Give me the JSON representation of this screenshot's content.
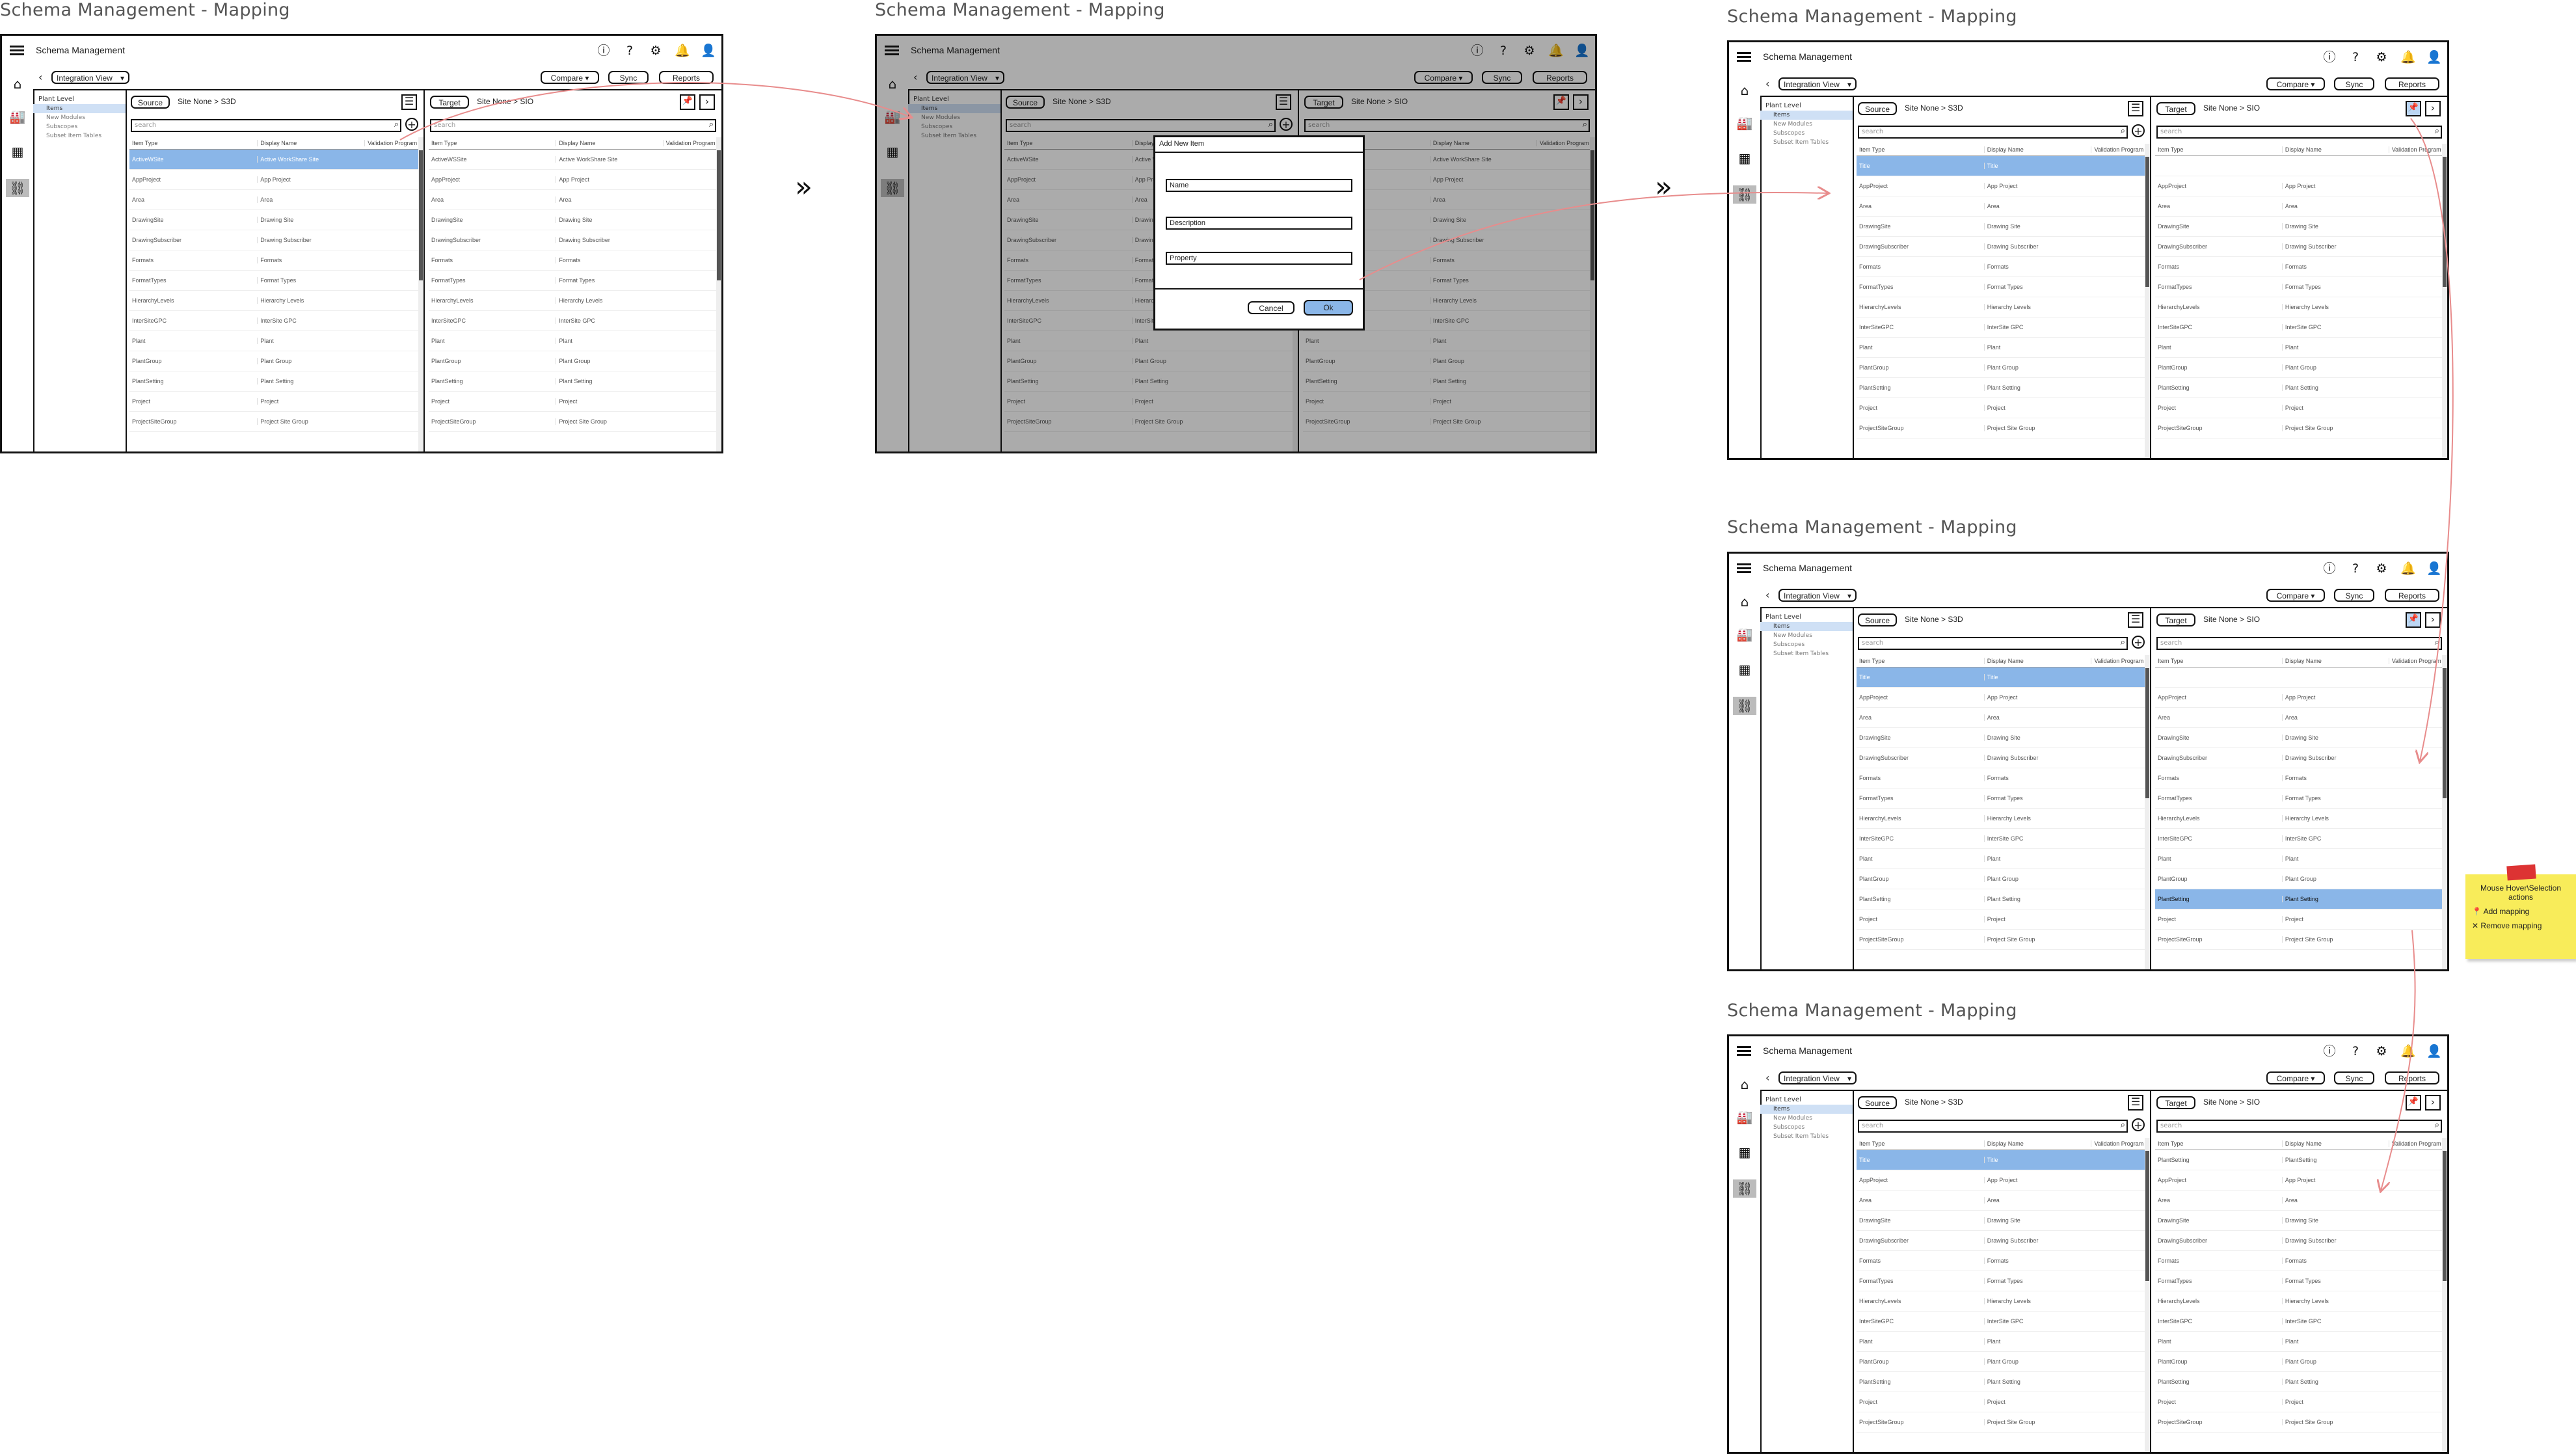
{
  "frame_title": "Schema Management - Mapping",
  "app_title": "Schema Management",
  "view_select": "Integration View",
  "compare": "Compare",
  "sync": "Sync",
  "reports": "Reports",
  "source_label": "Source",
  "source_path": "Site None > S3D",
  "target_label": "Target",
  "target_path": "Site None > SIO",
  "search_placeholder": "search",
  "col_item_type": "Item Type",
  "col_display_name": "Display Name",
  "col_validation": "Validation Program",
  "tree": {
    "root": "Plant Level",
    "items": [
      "Items",
      "New Modules",
      "Subscopes",
      "Subset Item Tables"
    ]
  },
  "source_rows_a": [
    [
      "ActiveWSite",
      "Active WorkShare Site"
    ],
    [
      "AppProject",
      "App Project"
    ],
    [
      "Area",
      "Area"
    ],
    [
      "DrawingSite",
      "Drawing Site"
    ],
    [
      "DrawingSubscriber",
      "Drawing Subscriber"
    ],
    [
      "Formats",
      "Formats"
    ],
    [
      "FormatTypes",
      "Format Types"
    ],
    [
      "HierarchyLevels",
      "Hierarchy Levels"
    ],
    [
      "InterSiteGPC",
      "InterSite GPC"
    ],
    [
      "Plant",
      "Plant"
    ],
    [
      "PlantGroup",
      "Plant Group"
    ],
    [
      "PlantSetting",
      "Plant Setting"
    ],
    [
      "Project",
      "Project"
    ],
    [
      "ProjectSiteGroup",
      "Project Site Group"
    ]
  ],
  "source_rows_b": [
    [
      "Title",
      "Title"
    ],
    [
      "AppProject",
      "App Project"
    ],
    [
      "Area",
      "Area"
    ],
    [
      "DrawingSite",
      "Drawing Site"
    ],
    [
      "DrawingSubscriber",
      "Drawing Subscriber"
    ],
    [
      "Formats",
      "Formats"
    ],
    [
      "FormatTypes",
      "Format Types"
    ],
    [
      "HierarchyLevels",
      "Hierarchy Levels"
    ],
    [
      "InterSiteGPC",
      "InterSite GPC"
    ],
    [
      "Plant",
      "Plant"
    ],
    [
      "PlantGroup",
      "Plant Group"
    ],
    [
      "PlantSetting",
      "Plant Setting"
    ],
    [
      "Project",
      "Project"
    ],
    [
      "ProjectSiteGroup",
      "Project Site Group"
    ]
  ],
  "target_rows_a": [
    [
      "ActiveWSSite",
      "Active WorkShare Site"
    ],
    [
      "AppProject",
      "App Project"
    ],
    [
      "Area",
      "Area"
    ],
    [
      "DrawingSite",
      "Drawing Site"
    ],
    [
      "DrawingSubscriber",
      "Drawing Subscriber"
    ],
    [
      "Formats",
      "Formats"
    ],
    [
      "FormatTypes",
      "Format Types"
    ],
    [
      "HierarchyLevels",
      "Hierarchy Levels"
    ],
    [
      "InterSiteGPC",
      "InterSite GPC"
    ],
    [
      "Plant",
      "Plant"
    ],
    [
      "PlantGroup",
      "Plant Group"
    ],
    [
      "PlantSetting",
      "Plant Setting"
    ],
    [
      "Project",
      "Project"
    ],
    [
      "ProjectSiteGroup",
      "Project Site Group"
    ]
  ],
  "target_rows_b": [
    [
      "",
      ""
    ],
    [
      "AppProject",
      "App Project"
    ],
    [
      "Area",
      "Area"
    ],
    [
      "DrawingSite",
      "Drawing Site"
    ],
    [
      "DrawingSubscriber",
      "Drawing Subscriber"
    ],
    [
      "Formats",
      "Formats"
    ],
    [
      "FormatTypes",
      "Format Types"
    ],
    [
      "HierarchyLevels",
      "Hierarchy Levels"
    ],
    [
      "InterSiteGPC",
      "InterSite GPC"
    ],
    [
      "Plant",
      "Plant"
    ],
    [
      "PlantGroup",
      "Plant Group"
    ],
    [
      "PlantSetting",
      "Plant Setting"
    ],
    [
      "Project",
      "Project"
    ],
    [
      "ProjectSiteGroup",
      "Project Site Group"
    ]
  ],
  "target_rows_c": [
    [
      "PlantSetting",
      "PlantSetting"
    ],
    [
      "AppProject",
      "App Project"
    ],
    [
      "Area",
      "Area"
    ],
    [
      "DrawingSite",
      "Drawing Site"
    ],
    [
      "DrawingSubscriber",
      "Drawing Subscriber"
    ],
    [
      "Formats",
      "Formats"
    ],
    [
      "FormatTypes",
      "Format Types"
    ],
    [
      "HierarchyLevels",
      "Hierarchy Levels"
    ],
    [
      "InterSiteGPC",
      "InterSite GPC"
    ],
    [
      "Plant",
      "Plant"
    ],
    [
      "PlantGroup",
      "Plant Group"
    ],
    [
      "PlantSetting",
      "Plant Setting"
    ],
    [
      "Project",
      "Project"
    ],
    [
      "ProjectSiteGroup",
      "Project Site Group"
    ]
  ],
  "dialog": {
    "title": "Add New Item",
    "name": "Name",
    "description": "Description",
    "property": "Property",
    "cancel": "Cancel",
    "ok": "Ok"
  },
  "sticky": {
    "title": "Mouse Hover\\Selection actions",
    "add": "Add mapping",
    "remove": "Remove mapping"
  },
  "colors": {
    "selection": "#8ab6e8",
    "arrow": "#e88c8c",
    "sticky": "#f8ec5a",
    "pin": "#d22"
  }
}
